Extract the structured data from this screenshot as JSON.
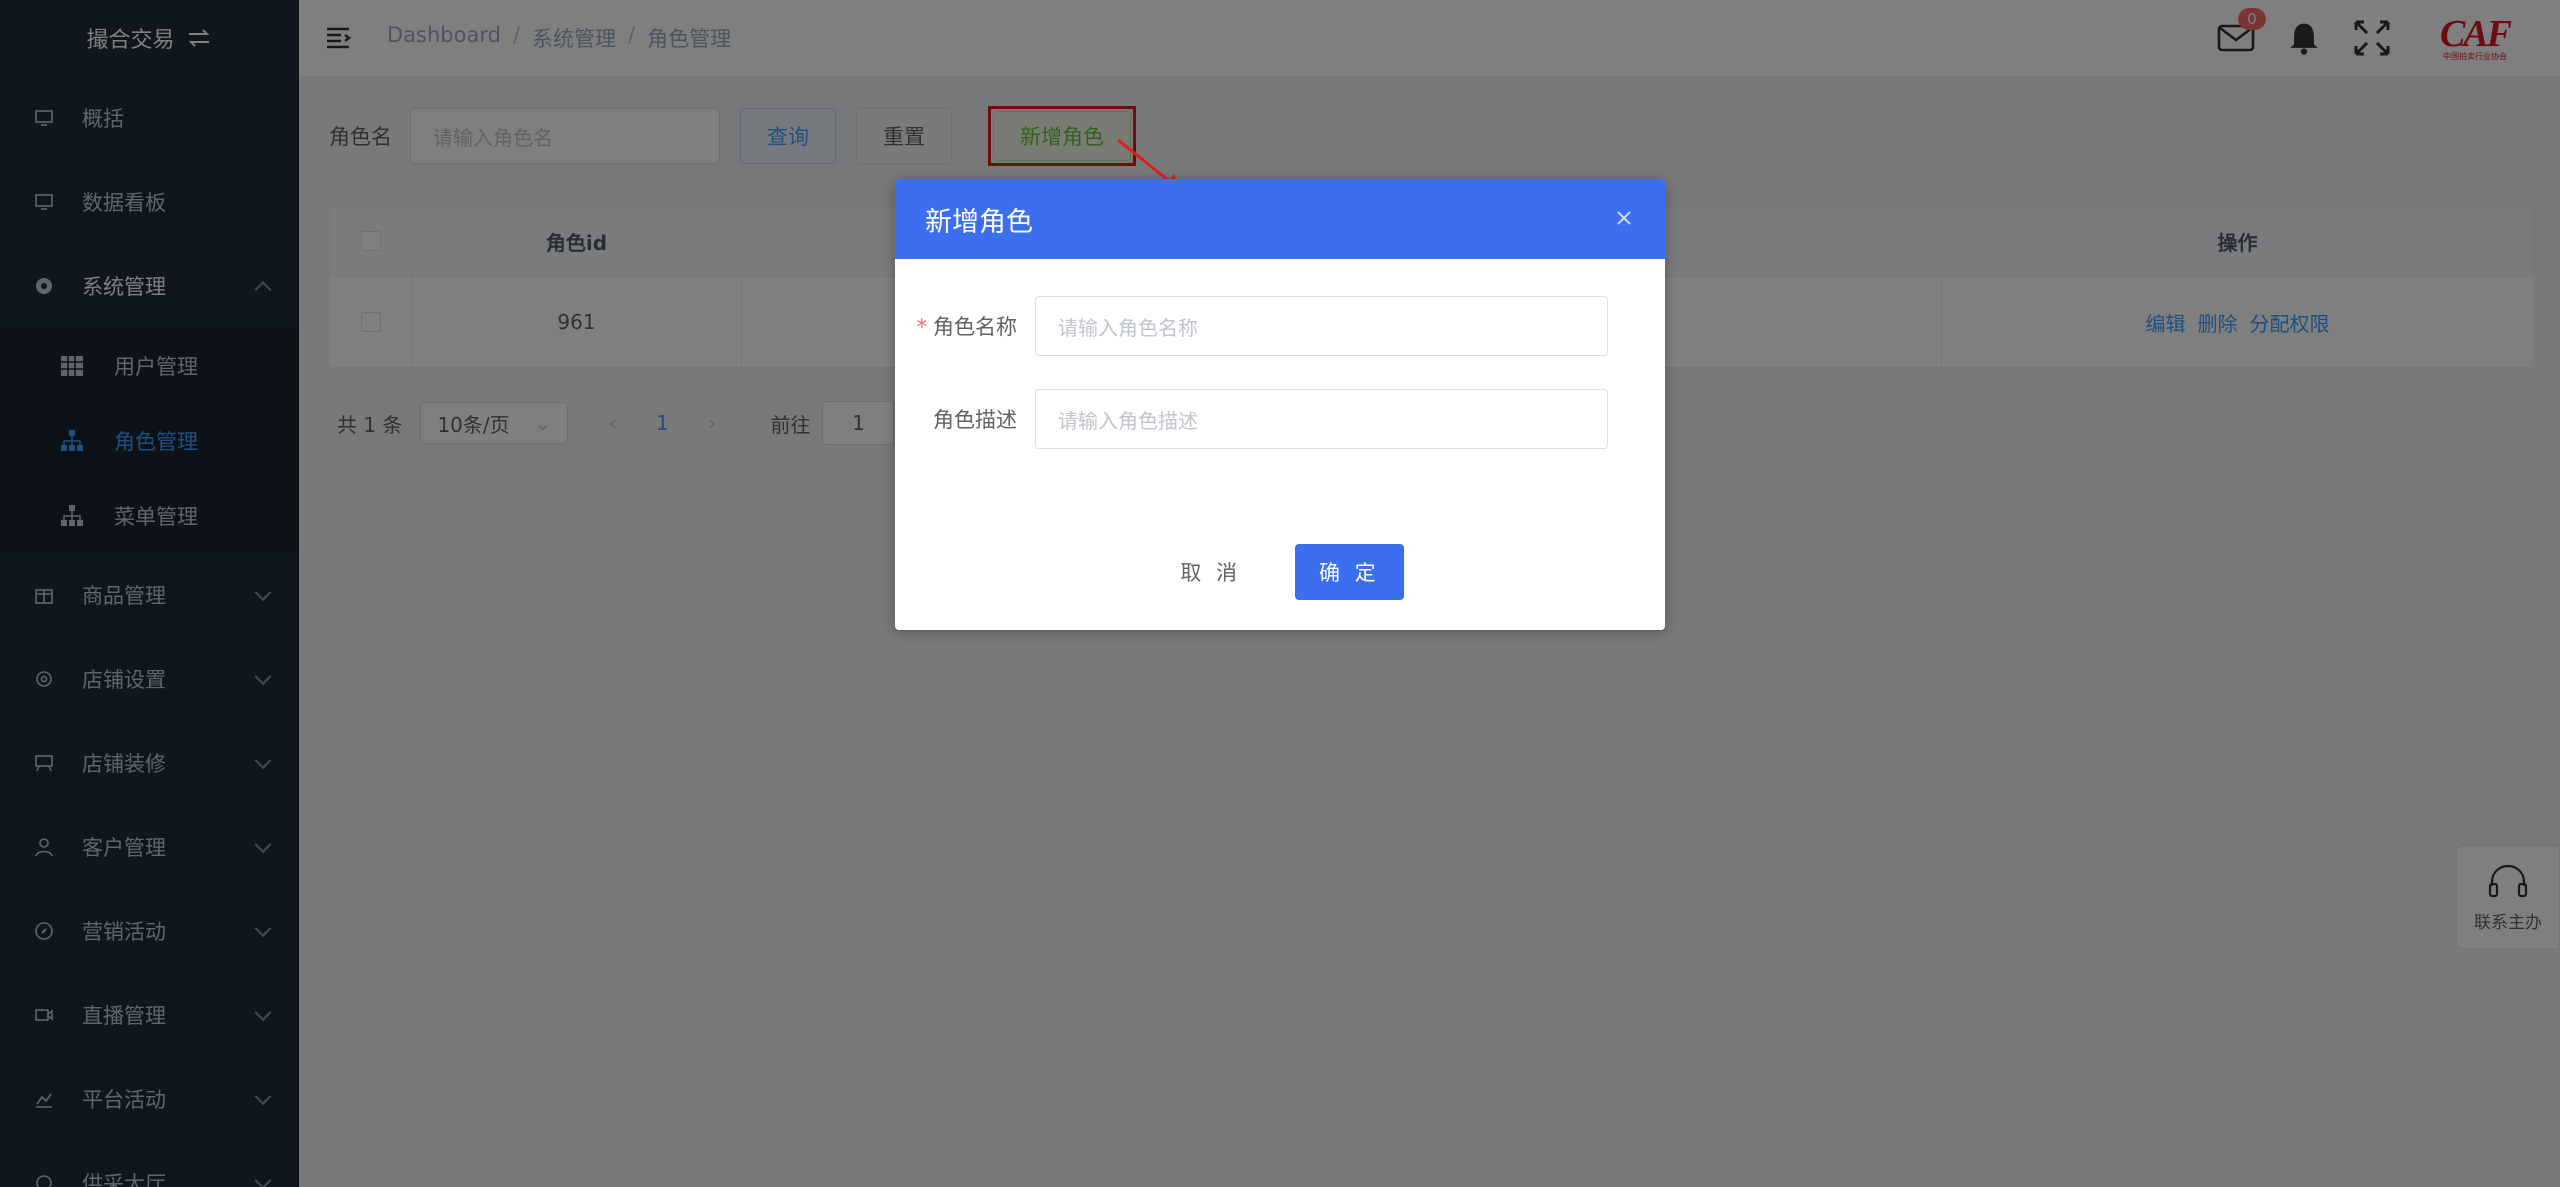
{
  "sidebar": {
    "title": "撮合交易",
    "items": [
      {
        "label": "概括"
      },
      {
        "label": "数据看板"
      },
      {
        "label": "系统管理"
      },
      {
        "label": "商品管理"
      },
      {
        "label": "店铺设置"
      },
      {
        "label": "店铺装修"
      },
      {
        "label": "客户管理"
      },
      {
        "label": "营销活动"
      },
      {
        "label": "直播管理"
      },
      {
        "label": "平台活动"
      },
      {
        "label": "供采大厅"
      }
    ],
    "sub_items": [
      {
        "label": "用户管理"
      },
      {
        "label": "角色管理"
      },
      {
        "label": "菜单管理"
      }
    ]
  },
  "breadcrumb": [
    "Dashboard",
    "系统管理",
    "角色管理"
  ],
  "header": {
    "mail_badge": "0",
    "logo_text": "CAF",
    "logo_sub": "中国拍卖行业协会"
  },
  "filter": {
    "label": "角色名",
    "placeholder": "请输入角色名",
    "query_label": "查询",
    "reset_label": "重置",
    "add_label": "新增角色"
  },
  "table": {
    "columns": [
      "角色id",
      "操作"
    ],
    "rows": [
      {
        "id": "961",
        "ops": [
          "编辑",
          "删除",
          "分配权限"
        ]
      }
    ]
  },
  "pager": {
    "total": "共 1 条",
    "page_size": "10条/页",
    "current": "1",
    "goto_label": "前往",
    "goto_value": "1"
  },
  "help": {
    "label": "联系主办"
  },
  "dialog": {
    "title": "新增角色",
    "fields": [
      {
        "label": "角色名称",
        "placeholder": "请输入角色名称",
        "required": true
      },
      {
        "label": "角色描述",
        "placeholder": "请输入角色描述",
        "required": false
      }
    ],
    "cancel_label": "取 消",
    "ok_label": "确 定"
  },
  "colors": {
    "sidebar_bg": "#1f2d3d",
    "primary": "#3c6ef0",
    "link": "#409eff",
    "add_green": "#67c23a",
    "highlight_red": "#e11c1c"
  }
}
